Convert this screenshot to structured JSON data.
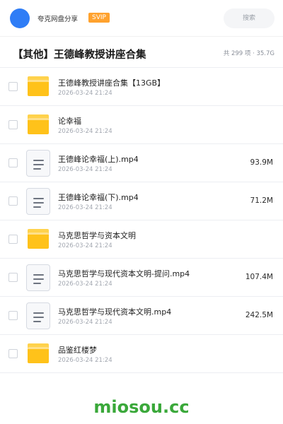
{
  "header": {
    "app_name": "夸克网盘分享",
    "vip_badge": "SVIP",
    "search_label": "搜索"
  },
  "folder": {
    "title": "【其他】王德峰教授讲座合集",
    "meta": "共 299 项 · 35.7G"
  },
  "items": [
    {
      "type": "folder",
      "icon": "folder-icon",
      "name": "王德峰教授讲座合集【13GB】",
      "date": "2026-03-24 21:24",
      "size": ""
    },
    {
      "type": "folder",
      "icon": "folder-icon",
      "name": "论幸福",
      "date": "2026-03-24 21:24",
      "size": ""
    },
    {
      "type": "file",
      "icon": "document-icon",
      "name": "王德峰论幸福(上).mp4",
      "date": "2026-03-24 21:24",
      "size": "93.9M"
    },
    {
      "type": "file",
      "icon": "document-icon",
      "name": "王德峰论幸福(下).mp4",
      "date": "2026-03-24 21:24",
      "size": "71.2M"
    },
    {
      "type": "folder",
      "icon": "folder-icon",
      "name": "马克思哲学与资本文明",
      "date": "2026-03-24 21:24",
      "size": ""
    },
    {
      "type": "file",
      "icon": "document-icon",
      "name": "马克思哲学与现代资本文明-提问.mp4",
      "date": "2026-03-24 21:24",
      "size": "107.4M"
    },
    {
      "type": "file",
      "icon": "document-icon",
      "name": "马克思哲学与现代资本文明.mp4",
      "date": "2026-03-24 21:24",
      "size": "242.5M"
    },
    {
      "type": "folder",
      "icon": "folder-icon",
      "name": "品鉴红楼梦",
      "date": "2026-03-24 21:24",
      "size": ""
    }
  ],
  "watermark": "miosou.cc",
  "colors": {
    "accent": "#2f7df6",
    "vip": "#ffa22e",
    "folder": "#ffc21a",
    "watermark": "#3aa83a"
  }
}
